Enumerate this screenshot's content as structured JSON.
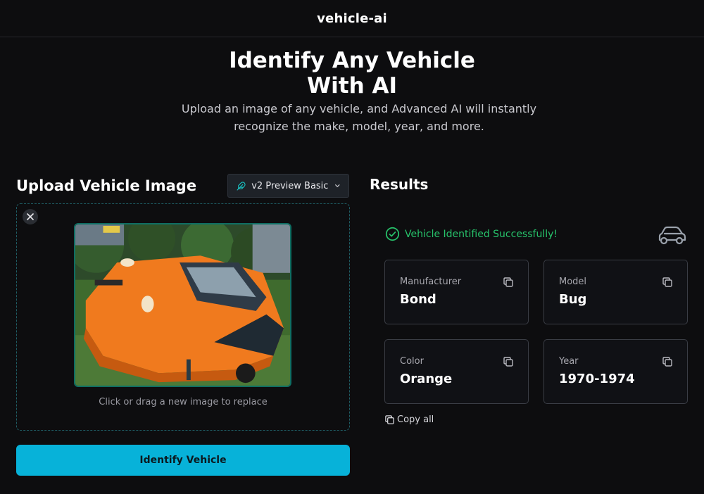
{
  "header": {
    "brand": "vehicle-ai"
  },
  "hero": {
    "title_line1": "Identify Any Vehicle",
    "title_line2": "With AI",
    "subtitle": "Upload an image of any vehicle, and Advanced AI will instantly recognize the make, model, year, and more."
  },
  "upload": {
    "title": "Upload Vehicle Image",
    "model_selected": "v2 Preview Basic",
    "hint": "Click or drag a new image to replace",
    "button_label": "Identify Vehicle"
  },
  "results": {
    "title": "Results",
    "status": "Vehicle Identified Successfully!",
    "fields": [
      {
        "label": "Manufacturer",
        "value": "Bond"
      },
      {
        "label": "Model",
        "value": "Bug"
      },
      {
        "label": "Color",
        "value": "Orange"
      },
      {
        "label": "Year",
        "value": "1970-1974"
      }
    ],
    "copy_all_label": "Copy all"
  },
  "colors": {
    "background": "#0d0d0f",
    "accent": "#07b2d9",
    "success": "#27c36b",
    "vehicle_orange": "#f07a1e"
  },
  "icons": [
    "feather-icon",
    "chevron-down-icon",
    "close-icon",
    "check-circle-icon",
    "car-icon",
    "copy-icon"
  ]
}
